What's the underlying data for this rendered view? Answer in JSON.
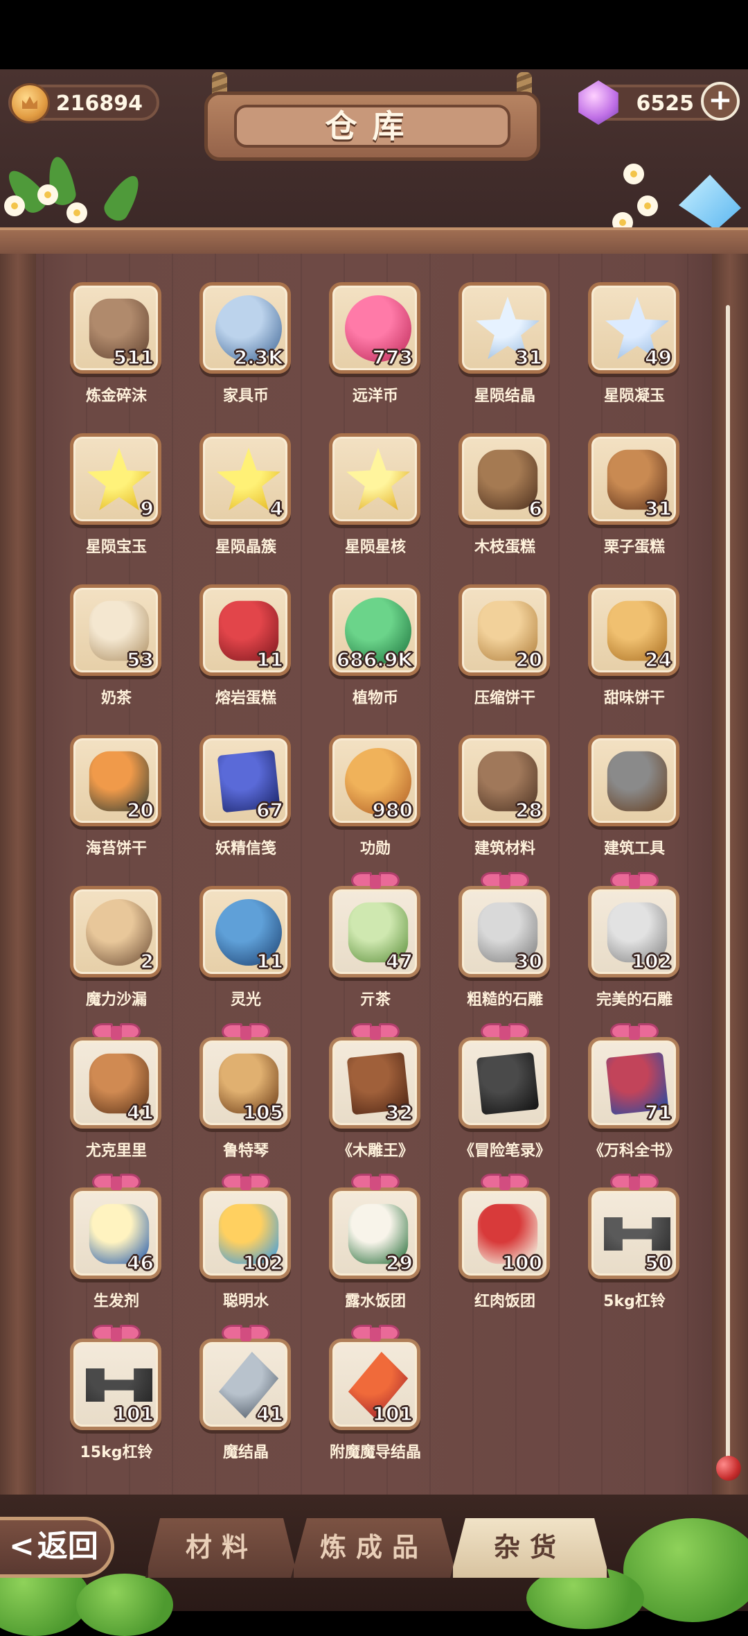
{
  "header": {
    "title": "仓库",
    "gold": "216894",
    "gems": "6525",
    "plus_symbol": "+"
  },
  "items": [
    {
      "name": "炼金碎沫",
      "count": "511",
      "icon": "rock-chunk-icon",
      "gift": false
    },
    {
      "name": "家具币",
      "count": "2.3K",
      "icon": "furniture-coin-icon",
      "gift": false
    },
    {
      "name": "远洋币",
      "count": "773",
      "icon": "ocean-coin-icon",
      "gift": false
    },
    {
      "name": "星陨结晶",
      "count": "31",
      "icon": "star-crystal-icon",
      "gift": false
    },
    {
      "name": "星陨凝玉",
      "count": "49",
      "icon": "star-jade-icon",
      "gift": false
    },
    {
      "name": "星陨宝玉",
      "count": "9",
      "icon": "star-gem-icon",
      "gift": false
    },
    {
      "name": "星陨晶簇",
      "count": "4",
      "icon": "star-cluster-icon",
      "gift": false
    },
    {
      "name": "星陨星核",
      "count": "",
      "icon": "star-core-icon",
      "gift": false
    },
    {
      "name": "木枝蛋糕",
      "count": "6",
      "icon": "log-cake-icon",
      "gift": false
    },
    {
      "name": "栗子蛋糕",
      "count": "31",
      "icon": "chestnut-cake-icon",
      "gift": false
    },
    {
      "name": "奶茶",
      "count": "53",
      "icon": "milk-tea-icon",
      "gift": false
    },
    {
      "name": "熔岩蛋糕",
      "count": "11",
      "icon": "lava-cake-icon",
      "gift": false
    },
    {
      "name": "植物币",
      "count": "686.9K",
      "icon": "plant-coin-icon",
      "gift": false
    },
    {
      "name": "压缩饼干",
      "count": "20",
      "icon": "compressed-biscuit-icon",
      "gift": false
    },
    {
      "name": "甜味饼干",
      "count": "24",
      "icon": "sweet-cracker-icon",
      "gift": false
    },
    {
      "name": "海苔饼干",
      "count": "20",
      "icon": "seaweed-cracker-icon",
      "gift": false
    },
    {
      "name": "妖精信笺",
      "count": "67",
      "icon": "fairy-letter-icon",
      "gift": false
    },
    {
      "name": "功勋",
      "count": "980",
      "icon": "medal-icon",
      "gift": false
    },
    {
      "name": "建筑材料",
      "count": "28",
      "icon": "building-material-icon",
      "gift": false
    },
    {
      "name": "建筑工具",
      "count": "",
      "icon": "hammer-tool-icon",
      "gift": false
    },
    {
      "name": "魔力沙漏",
      "count": "2",
      "icon": "hourglass-icon",
      "gift": false
    },
    {
      "name": "灵光",
      "count": "11",
      "icon": "lightbulb-icon",
      "gift": false
    },
    {
      "name": "亓茶",
      "count": "47",
      "icon": "tea-bowl-icon",
      "gift": true
    },
    {
      "name": "粗糙的石雕",
      "count": "30",
      "icon": "rough-statue-icon",
      "gift": true
    },
    {
      "name": "完美的石雕",
      "count": "102",
      "icon": "perfect-statue-icon",
      "gift": true
    },
    {
      "name": "尤克里里",
      "count": "41",
      "icon": "ukulele-icon",
      "gift": true
    },
    {
      "name": "鲁特琴",
      "count": "105",
      "icon": "lute-icon",
      "gift": true
    },
    {
      "name": "《木雕王》",
      "count": "32",
      "icon": "brown-book-icon",
      "gift": true
    },
    {
      "name": "《冒险笔录》",
      "count": "",
      "icon": "black-book-icon",
      "gift": true
    },
    {
      "name": "《万科全书》",
      "count": "71",
      "icon": "red-book-icon",
      "gift": true
    },
    {
      "name": "生发剂",
      "count": "46",
      "icon": "potion-bottle-icon",
      "gift": true
    },
    {
      "name": "聪明水",
      "count": "102",
      "icon": "scarf-jar-icon",
      "gift": true
    },
    {
      "name": "露水饭团",
      "count": "29",
      "icon": "rice-ball-icon",
      "gift": true
    },
    {
      "name": "红肉饭团",
      "count": "100",
      "icon": "red-rice-ball-icon",
      "gift": true
    },
    {
      "name": "5kg杠铃",
      "count": "50",
      "icon": "dumbbell-icon",
      "gift": true
    },
    {
      "name": "15kg杠铃",
      "count": "101",
      "icon": "heavy-dumbbell-icon",
      "gift": true
    },
    {
      "name": "魔结晶",
      "count": "41",
      "icon": "magic-crystal-icon",
      "gift": true
    },
    {
      "name": "附魔魔导结晶",
      "count": "101",
      "icon": "enchanted-crystal-icon",
      "gift": true
    }
  ],
  "tabs": [
    {
      "label": "材料",
      "active": false
    },
    {
      "label": "炼成品",
      "active": false
    },
    {
      "label": "杂货",
      "active": true
    }
  ],
  "back": {
    "label": "返回",
    "arrow": "<"
  },
  "colors": {
    "tile_border": "#a9724b",
    "board": "#6e4a45",
    "bow": "#ea6a98",
    "active_tab": "#f1e3c7"
  }
}
